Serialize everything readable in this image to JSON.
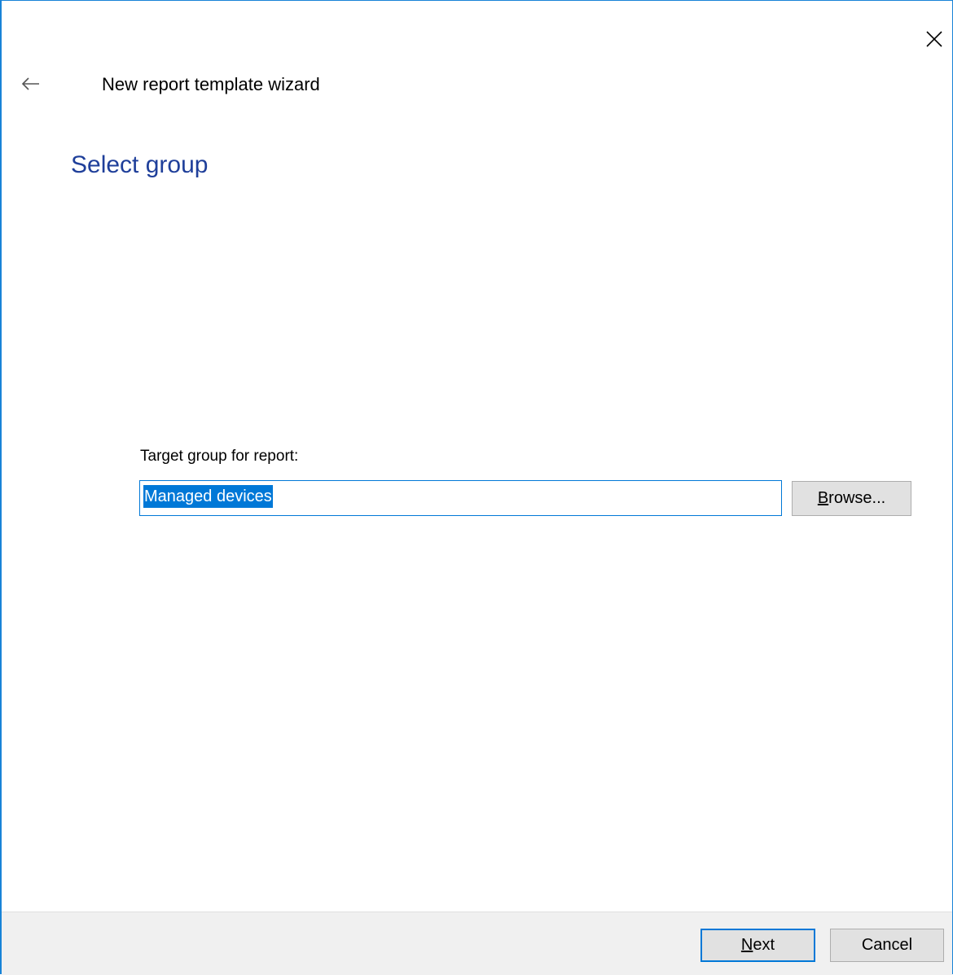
{
  "window": {
    "title": "New report template wizard",
    "close_icon": "close-icon",
    "back_icon": "back-arrow-icon"
  },
  "page": {
    "heading": "Select group"
  },
  "form": {
    "target_group_label": "Target group for report:",
    "target_group_value": "Managed devices",
    "browse_button_label_accel": "B",
    "browse_button_label_rest": "rowse..."
  },
  "footer": {
    "next_label_accel": "N",
    "next_label_rest": "ext",
    "cancel_label": "Cancel"
  },
  "colors": {
    "accent": "#0078d7",
    "heading": "#1f3f9a",
    "window_border": "#1883d7",
    "footer_bg": "#f0f0f0",
    "button_bg": "#e1e1e1"
  }
}
